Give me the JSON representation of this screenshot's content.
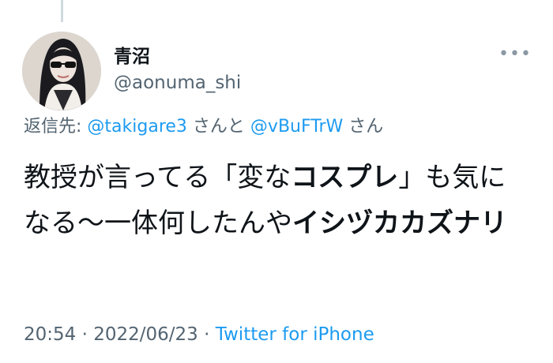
{
  "tweet": {
    "author": {
      "display_name": "青沼",
      "handle": "@aonuma_shi"
    },
    "reply_to": {
      "prefix": "返信先: ",
      "user1": "@takigare3",
      "joiner": "さんと",
      "user2": "@vBuFTrW",
      "suffix": "さん"
    },
    "text": {
      "part1": "教授が言ってる「変な",
      "part2_bold": "コスプレ",
      "part3": "」も気になる〜一体何したんや",
      "part4_bold": "イシヅカカズナリ"
    },
    "time": "20:54",
    "separator": " · ",
    "date": "2022/06/23",
    "source": "Twitter for iPhone"
  },
  "icons": {
    "more": "more-horizontal-icon"
  },
  "colors": {
    "link": "#1d9bf0",
    "secondary": "#536471",
    "text": "#0f1419"
  }
}
